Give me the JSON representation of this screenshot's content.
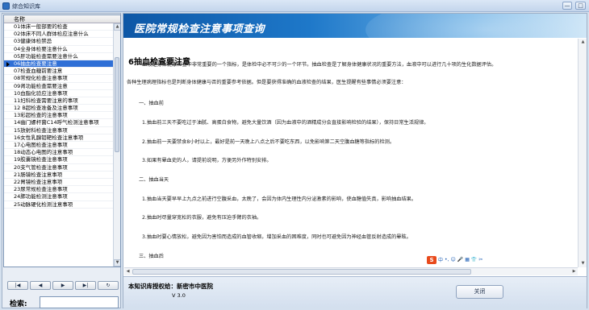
{
  "window": {
    "title": "综合知识库",
    "minimize_glyph": "—",
    "maximize_glyph": "□",
    "close_glyph": "✕"
  },
  "list": {
    "header": "名称",
    "items": [
      "01体床一般部要的检查",
      "02体床不同人群体检应注意什么",
      "03健康体检禁忌",
      "04全身体检要注意什么",
      "05肝功能检查需要注意什么",
      "06抽血检查要注意",
      "07检查血糖前要注意",
      "08常规化检查注意事项",
      "09肾功能检查需要注意",
      "10血脂化验应注意事项",
      "11妇科检查需要注意的事项",
      "12 B超检查准备及注意事项",
      "13彩超检查的注意事项",
      "14幽门螺杆菌C14呼气检测注意事项",
      "15放射科检查注意事项",
      "16女性乳腺钼靶检查注意事项",
      "17心电图检查注意事项",
      "18动态心电图的注意事项",
      "19胶囊镜检查注意事项",
      "20支气管检查注意事项",
      "21肠镜检查注意事项",
      "22胃镜检查注意事项",
      "23尿常规检查注意事项",
      "24肺功能检测注意事项",
      "25动脉硬化检测注意事项"
    ],
    "selected_index": 5
  },
  "nav": {
    "first": "|◀",
    "prev": "◀",
    "next": "▶",
    "last": "▶|",
    "refresh": "↻"
  },
  "search": {
    "label": "检索:",
    "value": ""
  },
  "banner": {
    "title": "医院常规检查注意事项查询"
  },
  "article": {
    "title": "6抽血检查要注意",
    "paragraphs": [
      "血液是身体健康检查中非常重要的一个指标，是体检中必不可少的一个环节。抽血检查是了解身体健康状况的重要方法，血液中可以进行几十项的生化数据评估。",
      "各种生理病理指标也是判断身体健康与否的重要参考依据。但是要获得准确的血液检查的结果，医生提醒有些事情必须要注意：",
      "一、抽血前",
      "1.抽血前三天不要吃过于油腻、高蛋白食物，避免大量饮酒（因为血液中的酒精成分会直接影响检验的结果），保持日常生活规律。",
      "2.抽血前一天要禁食8小时以上，最好是前一天晚上八点之后不要吃东西，以免影响第二天空腹血糖等指标的检测。",
      "3.如果有晕血史的人，请提前说明，方便另外作特别安排。",
      "二、抽血当天",
      "1.抽血当天要早早上九点之前进行空腹采血，太晚了，会因为体内生理性内分泌激素的影响，使血糖值失真，影响抽血结果。",
      "2.抽血时尽量穿宽松的衣服，避免有压迫手臂的衣袖。",
      "3.抽血时要心情放松，避免因为害怕而造成的血管收缩，增加采血的困难度，同时也可避免因为神经血管反射造成的晕眩。",
      "三、抽血后"
    ]
  },
  "ime": {
    "logo": "S",
    "items": [
      "中",
      "•,",
      "☺",
      "🎤",
      "▦",
      "👕",
      "✂"
    ]
  },
  "footer": {
    "licensee": "本知识库授权给：新密市中医院",
    "version": "V 3.0",
    "close_label": "关闭"
  }
}
